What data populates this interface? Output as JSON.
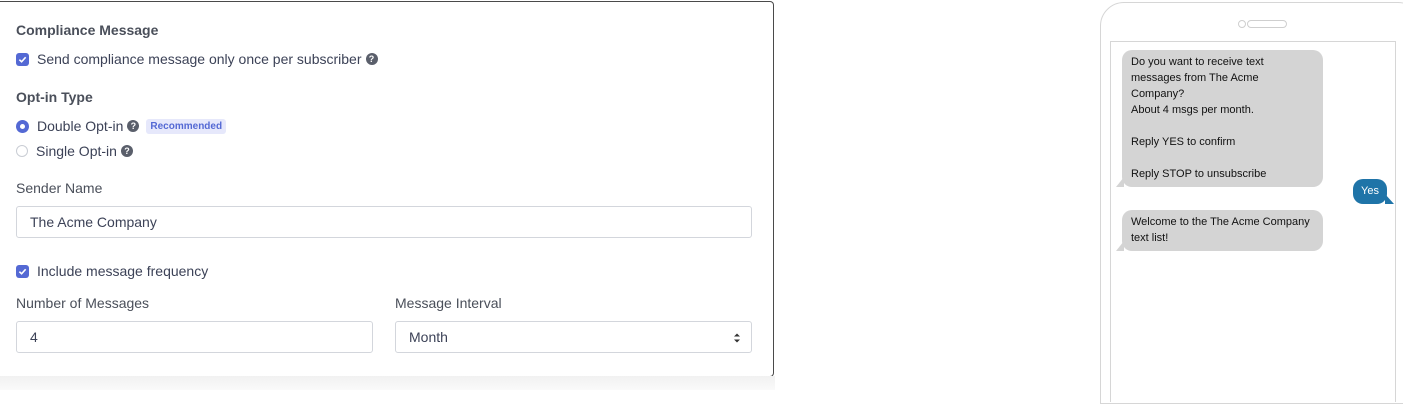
{
  "compliance": {
    "heading": "Compliance Message",
    "send_once_label": "Send compliance message only once per subscriber",
    "send_once_checked": true
  },
  "optin": {
    "heading": "Opt-in Type",
    "double_label": "Double Opt-in",
    "recommended_badge": "Recommended",
    "single_label": "Single Opt-in",
    "selected": "Double Opt-in"
  },
  "sender": {
    "heading": "Sender Name",
    "value": "The Acme Company"
  },
  "frequency": {
    "include_label": "Include message frequency",
    "include_checked": true,
    "num_heading": "Number of Messages",
    "num_value": "4",
    "interval_heading": "Message Interval",
    "interval_value": "Month"
  },
  "help_icon": "?",
  "preview": {
    "messages": [
      {
        "direction": "in",
        "text": "Do you want to receive text\nmessages from The Acme Company?\nAbout 4 msgs per month.\n\nReply YES to confirm\n\nReply STOP to unsubscribe"
      },
      {
        "direction": "out",
        "text": "Yes"
      },
      {
        "direction": "in",
        "text": "Welcome to the The Acme Company\ntext list!"
      }
    ]
  },
  "colors": {
    "accent": "#5469d4",
    "outgoing_bubble": "#1f74a8",
    "incoming_bubble": "#d4d4d4"
  }
}
